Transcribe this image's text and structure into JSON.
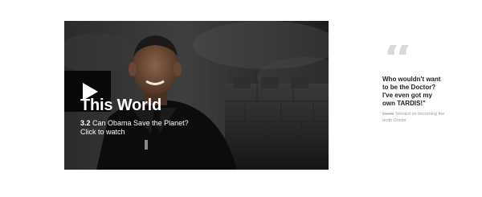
{
  "promo": {
    "title": "This World",
    "episode": "3.2",
    "episode_title": "Can Obama Save the Planet?",
    "cta": "Click to watch"
  },
  "quote": {
    "mark": "“",
    "text": "Who wouldn't want to be the Doctor? I've even got my own TARDIS!\"",
    "author": "David",
    "attribution": "Tennant on becoming the tenth Doctor"
  }
}
